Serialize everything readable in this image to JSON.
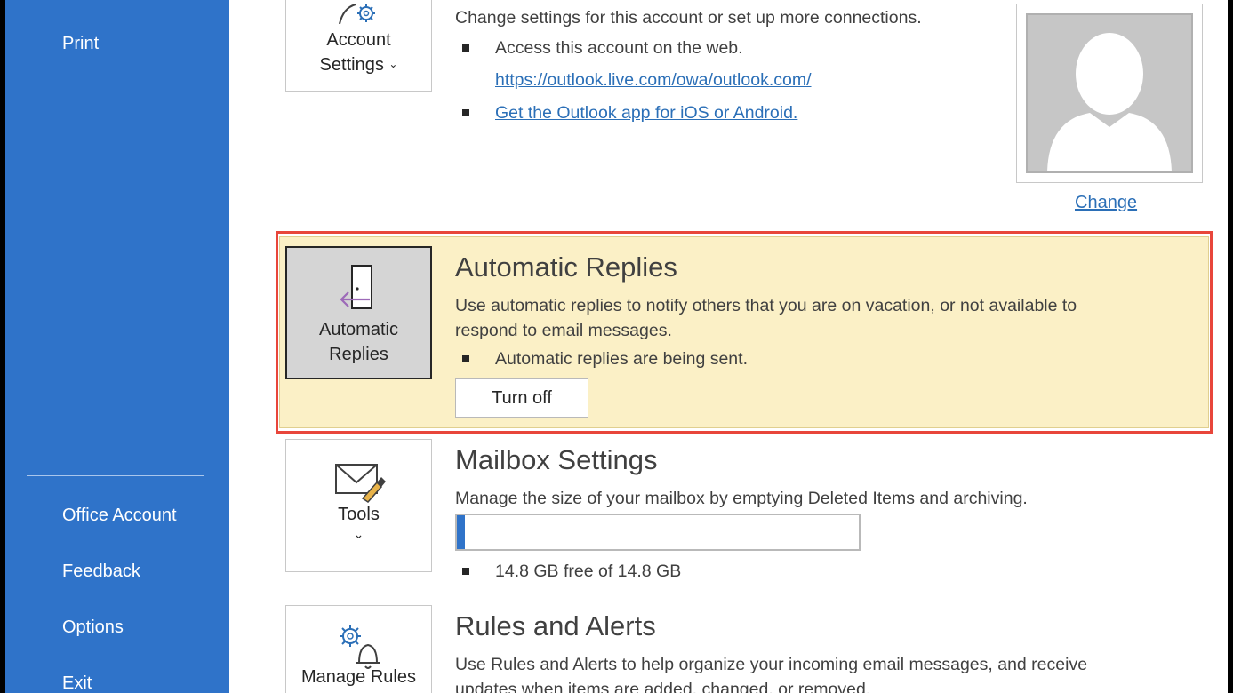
{
  "sidebar": {
    "print": "Print",
    "office_account": "Office Account",
    "feedback": "Feedback",
    "options": "Options",
    "exit": "Exit"
  },
  "account": {
    "tile_line1": "Account",
    "tile_line2": "Settings",
    "description": "Change settings for this account or set up more connections.",
    "web_access": "Access this account on the web.",
    "web_link": "https://outlook.live.com/owa/outlook.com/",
    "app_link": "Get the Outlook app for iOS or Android.",
    "change": "Change"
  },
  "auto_replies": {
    "tile_line1": "Automatic",
    "tile_line2": "Replies",
    "title": "Automatic Replies",
    "desc_line1": "Use automatic replies to notify others that you are on vacation, or not available to",
    "desc_line2": "respond to email messages.",
    "status": "Automatic replies are being sent.",
    "turn_off": "Turn off"
  },
  "mailbox": {
    "tile_label": "Tools",
    "title": "Mailbox Settings",
    "description": "Manage the size of your mailbox by emptying Deleted Items and archiving.",
    "storage": "14.8 GB free of 14.8 GB",
    "used_fraction": 0.02
  },
  "rules": {
    "tile_label": "Manage Rules",
    "title": "Rules and Alerts",
    "desc_line1": "Use Rules and Alerts to help organize your incoming email messages, and receive",
    "desc_line2": "updates when items are added, changed, or removed."
  },
  "colors": {
    "sidebar": "#2f73c9",
    "highlight_border": "#e8463b",
    "highlight_bg": "#fbf0c6",
    "link": "#2b6fb7"
  },
  "icons": [
    "account-settings-gear-icon",
    "chevron-down-icon",
    "door-arrow-icon",
    "envelope-brush-icon",
    "gear-bell-icon",
    "avatar-placeholder-icon"
  ]
}
